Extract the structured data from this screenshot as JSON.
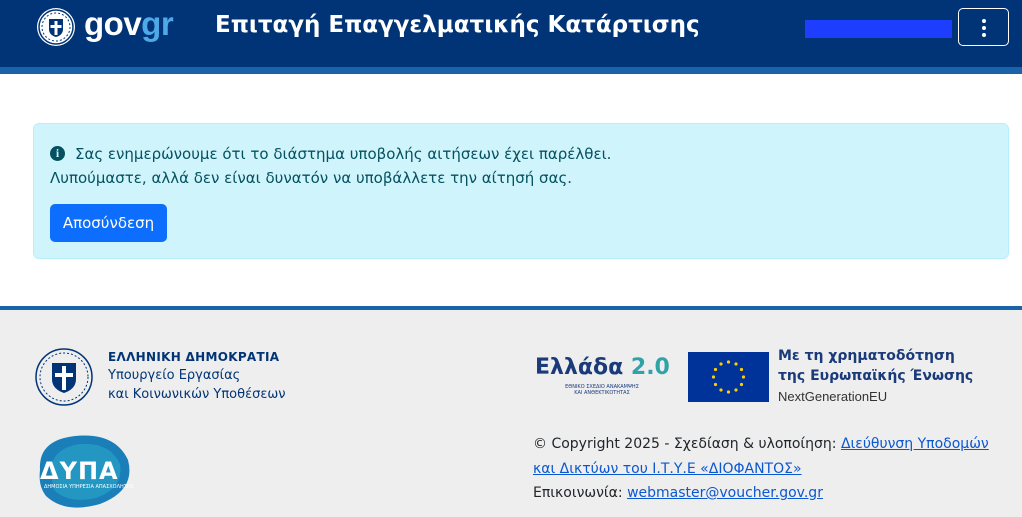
{
  "header": {
    "brand_gov": "gov",
    "brand_gr": "gr",
    "title": "Επιταγή Επαγγελματικής Κατάρτισης",
    "colors": {
      "background": "#003476",
      "stripe": "#1a63a8",
      "user_bar": "#1d3dff"
    },
    "menu_icon": "kebab-vertical-icon"
  },
  "alert": {
    "icon": "info-circle-icon",
    "line1": "Σας ενημερώνουμε ότι το διάστημα υποβολής αιτήσεων έχει παρέλθει.",
    "line2": "Λυπούμαστε, αλλά δεν είναι δυνατόν να υποβάλλετε την αίτησή σας.",
    "button_label": "Αποσύνδεση",
    "colors": {
      "background": "#cff4fc",
      "text": "#055160",
      "button": "#0d6efd"
    }
  },
  "footer": {
    "ministry": {
      "title": "ΕΛΛΗΝΙΚΗ ΔΗΜΟΚΡΑΤΙΑ",
      "line1": "Υπουργείο Εργασίας",
      "line2": "και Κοινωνικών Υποθέσεων"
    },
    "dypa": {
      "name": "ΔΥΠΑ",
      "subtitle": "ΔΗΜΟΣΙΑ ΥΠΗΡΕΣΙΑ ΑΠΑΣΧΟΛΗΣΗΣ"
    },
    "ellada": {
      "name": "Ελλάδα",
      "version": "2.0",
      "subtitle_line1": "ΕΘΝΙΚΟ ΣΧΕΔΙΟ ΑΝΑΚΑΜΨΗΣ",
      "subtitle_line2": "ΚΑΙ ΑΝΘΕΚΤΙΚΟΤΗΤΑΣ"
    },
    "eu": {
      "line1": "Με τη χρηματοδότηση",
      "line2": "της Ευρωπαϊκής Ένωσης",
      "line3": "NextGenerationEU"
    },
    "copyright_prefix": "© Copyright 2025 - Σχεδίαση & υλοποίηση: ",
    "copyright_link_1": "Διεύθυνση Υποδομών",
    "copyright_link_2": "και Δικτύων του Ι.Τ.Υ.Ε «ΔΙΟΦΑΝΤΟΣ»",
    "contact_prefix": "Επικοινωνία: ",
    "contact_email": "webmaster@voucher.gov.gr"
  }
}
